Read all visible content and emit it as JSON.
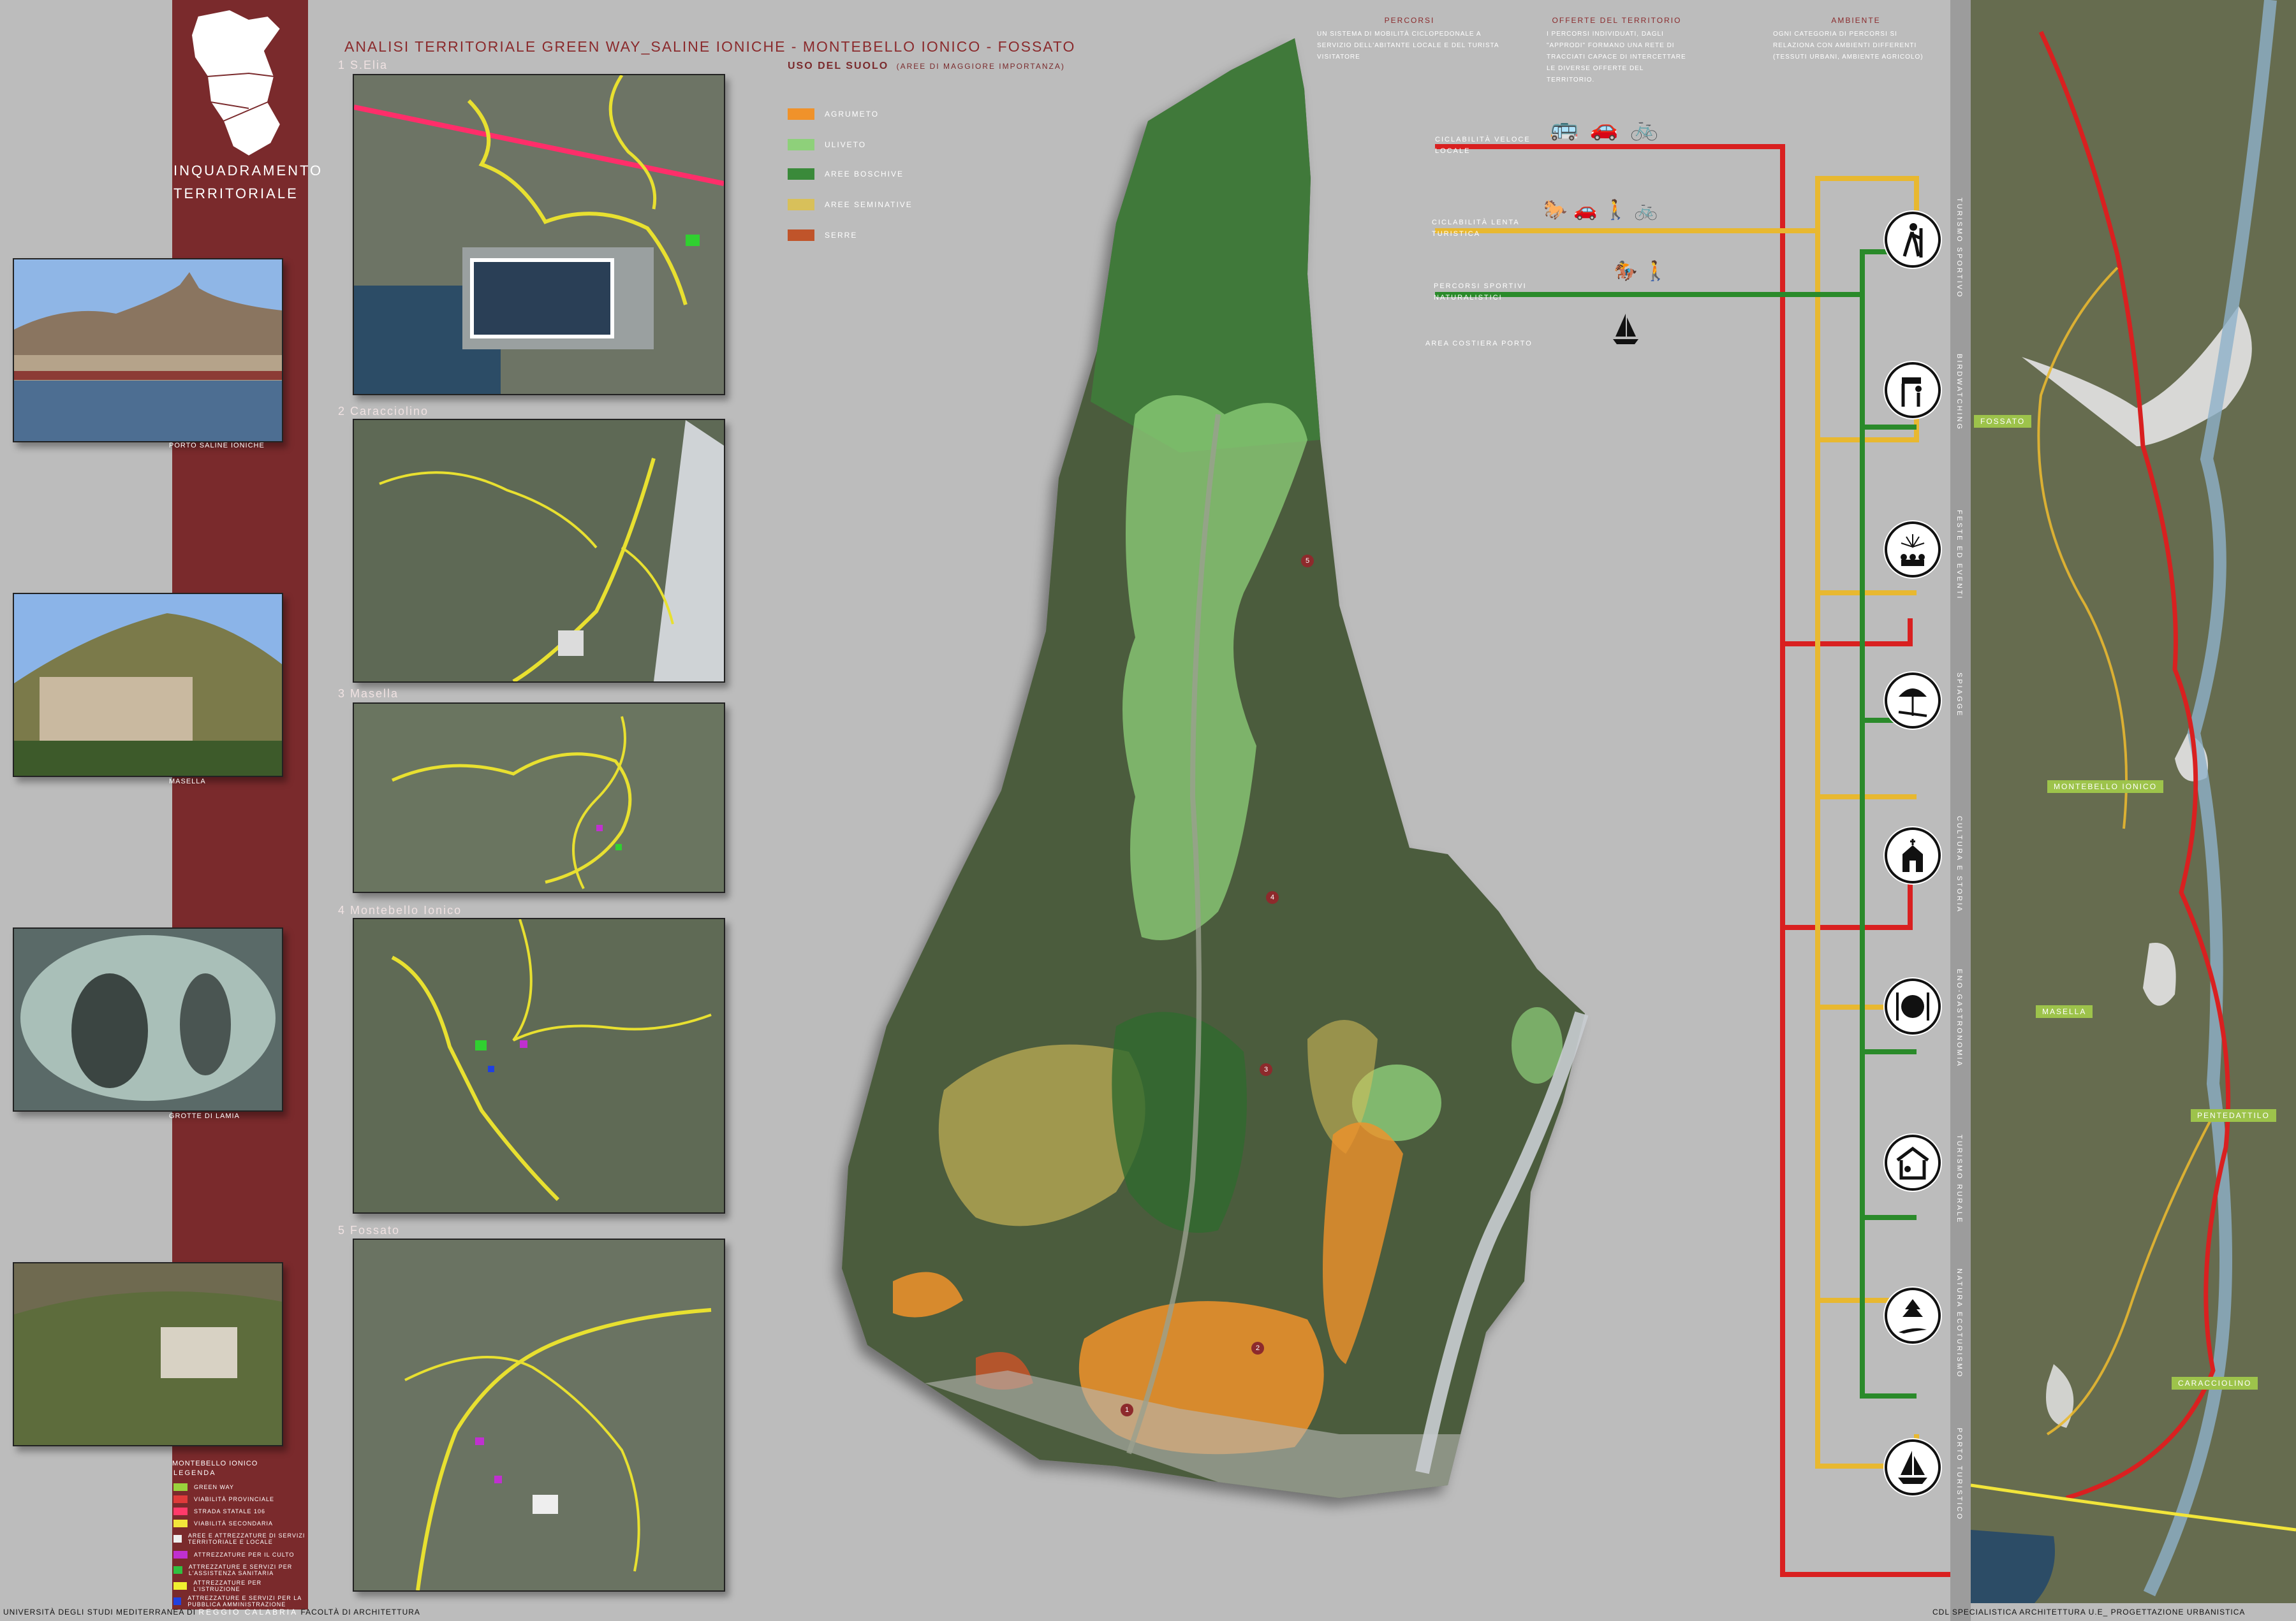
{
  "header": {
    "title": "ANALISI TERRITORIALE GREEN WAY_SALINE IONICHE - MONTEBELLO IONICO - FOSSATO",
    "inquadramento_line1": "INQUADRAMENTO",
    "inquadramento_line2": "TERRITORIALE"
  },
  "photos": [
    {
      "caption": "PORTO SALINE IONICHE"
    },
    {
      "caption": "MASELLA"
    },
    {
      "caption": "GROTTE DI LAMIA"
    },
    {
      "caption": "MONTEBELLO IONICO"
    }
  ],
  "detail_maps": [
    {
      "label": "1 S.Elia"
    },
    {
      "label": "2 Caracciolino"
    },
    {
      "label": "3 Masella"
    },
    {
      "label": "4 Montebello Ionico"
    },
    {
      "label": "5 Fossato"
    }
  ],
  "legend": {
    "title": "LEGENDA",
    "items": [
      {
        "label": "GREEN WAY",
        "color": "#9ad23c"
      },
      {
        "label": "VIABILITÀ PROVINCIALE",
        "color": "#e03a3a"
      },
      {
        "label": "STRADA STATALE 106",
        "color": "#ff3a6a"
      },
      {
        "label": "VIABILITÀ SECONDARIA",
        "color": "#f2e53a"
      },
      {
        "label": "AREE E ATTREZZATURE DI SERVIZI TERRITORIALE E LOCALE",
        "color": "#eeeeee"
      },
      {
        "label": "ATTREZZATURE PER IL CULTO",
        "color": "#c030d0"
      },
      {
        "label": "ATTREZZATURE E SERVIZI PER L'ASSISTENZA SANITARIA",
        "color": "#30c040"
      },
      {
        "label": "ATTREZZATURE PER L'ISTRUZIONE",
        "color": "#f0f030"
      },
      {
        "label": "ATTREZZATURE E SERVIZI PER LA PUBBLICA AMMINISTRAZIONE",
        "color": "#2040e0"
      }
    ]
  },
  "uso_suolo": {
    "title": "USO DEL SUOLO",
    "subtitle": "(AREE DI MAGGIORE IMPORTANZA)",
    "items": [
      {
        "label": "AGRUMETO",
        "color": "#f0922a"
      },
      {
        "label": "ULIVETO",
        "color": "#8ed07a"
      },
      {
        "label": "AREE BOSCHIVE",
        "color": "#3a8a3a"
      },
      {
        "label": "AREE SEMINATIVE",
        "color": "#d8c05a"
      },
      {
        "label": "SERRE",
        "color": "#c0542a"
      }
    ]
  },
  "info_columns": [
    {
      "title": "PERCORSI",
      "text": "UN SISTEMA DI MOBILITÀ CICLOPEDONALE A SERVIZIO DELL'ABITANTE LOCALE E DEL TURISTA VISITATORE"
    },
    {
      "title": "OFFERTE DEL TERRITORIO",
      "text": "I PERCORSI INDIVIDUATI, DAGLI \"APPRODI\" FORMANO UNA RETE DI TRACCIATI CAPACE DI INTERCETTARE LE DIVERSE OFFERTE DEL TERRITORIO."
    },
    {
      "title": "AMBIENTE",
      "text": "OGNI CATEGORIA DI PERCORSI SI RELAZIONA CON AMBIENTI DIFFERENTI (TESSUTI URBANI, AMBIENTE AGRICOLO)"
    }
  ],
  "percorsi": [
    {
      "label1": "CICLABILITÀ VELOCE",
      "label2": "LOCALE",
      "color": "#d92020"
    },
    {
      "label1": "CICLABILITÀ LENTA",
      "label2": "TURISTICA",
      "color": "#e8b830"
    },
    {
      "label1": "PERCORSI SPORTIVI",
      "label2": "NATURALISTICI",
      "color": "#2a8a2a"
    }
  ],
  "area_costiera": "AREA COSTIERA PORTO",
  "themes": [
    {
      "label": "TURISMO SPORTIVO",
      "icon": "hiker-icon"
    },
    {
      "label": "BIRDWATCHING",
      "icon": "birdwatching-icon"
    },
    {
      "label": "FESTE ED EVENTI",
      "icon": "fireworks-icon"
    },
    {
      "label": "SPIAGGE",
      "icon": "beach-umbrella-icon"
    },
    {
      "label": "CULTURA E STORIA",
      "icon": "church-icon"
    },
    {
      "label": "ENO-GASTRONOMIA",
      "icon": "dining-icon"
    },
    {
      "label": "TURISMO RURALE",
      "icon": "farmhouse-icon"
    },
    {
      "label": "NATURA ECOTURISMO",
      "icon": "tree-road-icon"
    },
    {
      "label": "PORTO TURISTICO",
      "icon": "sailboat-icon"
    }
  ],
  "map_places": [
    {
      "label": "FOSSATO"
    },
    {
      "label": "MONTEBELLO IONICO"
    },
    {
      "label": "MASELLA"
    },
    {
      "label": "PENTEDATTILO"
    },
    {
      "label": "CARACCIOLINO"
    }
  ],
  "footer": {
    "left_a": "UNIVERSITÀ DEGLI STUDI MEDITERRANEA DI",
    "left_b": "REGGIO CALABRIA",
    "left_c": "FACOLTÀ DI ARCHITETTURA",
    "right": "CDL SPECIALISTICA ARCHITETTURA U.E_ PROGETTAZIONE URBANISTICA"
  }
}
